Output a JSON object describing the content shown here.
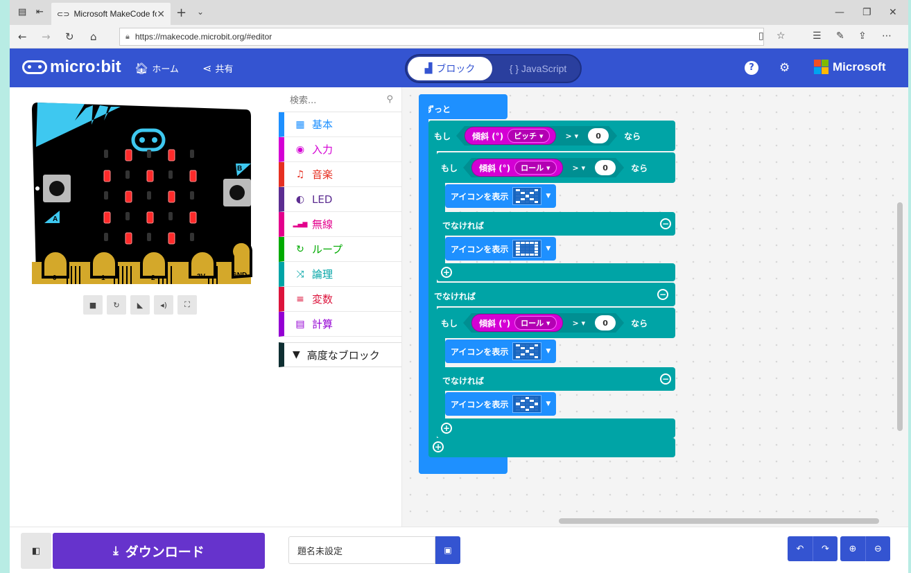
{
  "browser": {
    "tab_title": "Microsoft MakeCode fo",
    "tab_close": "✕",
    "new_tab": "+",
    "tab_menu": "⌄",
    "url": "https://makecode.microbit.org/#editor",
    "win_minimize": "—",
    "win_restore": "❐",
    "win_close": "✕"
  },
  "header": {
    "logo_text": "micro:bit",
    "home_label": "ホーム",
    "share_label": "共有",
    "blocks_label": "ブロック",
    "js_label": "{ } JavaScript",
    "help_icon": "?",
    "settings_icon": "⚙",
    "microsoft_label": "Microsoft",
    "ms_colors": [
      "#f25022",
      "#7fba00",
      "#00a4ef",
      "#ffb900"
    ]
  },
  "simulator": {
    "pins": [
      "0",
      "1",
      "2",
      "3V",
      "GND"
    ],
    "button_a": "A",
    "button_b": "B",
    "led_rows": [
      [
        0,
        1,
        0,
        1,
        0
      ],
      [
        1,
        0,
        1,
        0,
        1
      ],
      [
        0,
        1,
        0,
        1,
        0
      ],
      [
        1,
        0,
        1,
        0,
        1
      ],
      [
        0,
        1,
        0,
        1,
        0
      ]
    ],
    "led_color": "#ff2a2a"
  },
  "toolbox": {
    "search_placeholder": "検索...",
    "categories": [
      {
        "label": "基本",
        "color": "#1e90ff",
        "icon": "▦"
      },
      {
        "label": "入力",
        "color": "#d400d4",
        "icon": "◉"
      },
      {
        "label": "音楽",
        "color": "#e63022",
        "icon": "♫"
      },
      {
        "label": "LED",
        "color": "#5c2d91",
        "icon": "◐"
      },
      {
        "label": "無線",
        "color": "#e3008c",
        "icon": "▂▄▆"
      },
      {
        "label": "ループ",
        "color": "#00aa00",
        "icon": "↻"
      },
      {
        "label": "論理",
        "color": "#00a4a6",
        "icon": "⤨"
      },
      {
        "label": "変数",
        "color": "#dc143c",
        "icon": "≡"
      },
      {
        "label": "計算",
        "color": "#9400d3",
        "icon": "▤"
      }
    ],
    "advanced_label": "高度なブロック"
  },
  "workspace": {
    "forever_label": "ずっと",
    "if_label": "もし",
    "then_label": "なら",
    "else_label": "でなければ",
    "tilt_label": "傾斜 (°)",
    "pitch_label": "ピッチ ▾",
    "roll_label": "ロール ▾",
    "op_label": "> ▾",
    "zero": "0",
    "show_icon_label": "アイコンを表示"
  },
  "bottom": {
    "download_label": "ダウンロード",
    "project_name": "題名未設定"
  }
}
